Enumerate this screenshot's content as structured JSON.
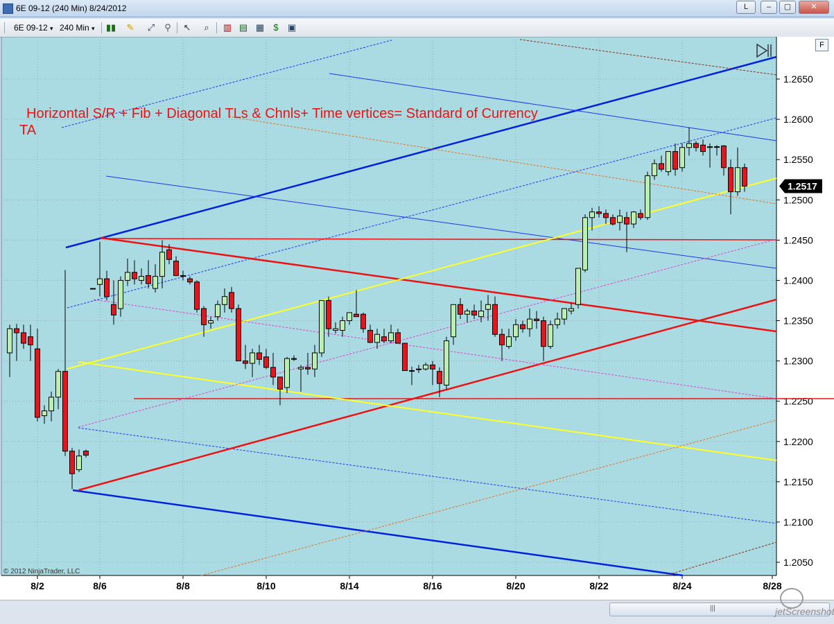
{
  "window": {
    "title": "6E 09-12 (240 Min)  8/24/2012",
    "btn_l": "L",
    "btn_min": "–",
    "btn_max": "▢",
    "btn_close": "✕"
  },
  "toolbar": {
    "instrument": "6E 09-12",
    "interval": "240 Min",
    "dropdown": "▾",
    "f_button": "F"
  },
  "chart_data": {
    "type": "candlestick",
    "title": "Horizontal S/R + Fib + Diagonal TLs & Chnls+ Time vertices= Standard of Currency",
    "title_line2": "TA",
    "copyright": "© 2012 NinjaTrader, LLC",
    "current_price": "1.2517",
    "ylim": [
      1.202,
      1.2715
    ],
    "y_ticks": [
      "1.2650",
      "1.2600",
      "1.2550",
      "1.2500",
      "1.2450",
      "1.2400",
      "1.2350",
      "1.2300",
      "1.2250",
      "1.2200",
      "1.2150",
      "1.2100",
      "1.2050"
    ],
    "x_labels": [
      "8/2",
      "8/6",
      "8/8",
      "8/10",
      "8/14",
      "8/16",
      "8/20",
      "8/22",
      "8/24",
      "8/28"
    ],
    "x_label_index": [
      4,
      13,
      25,
      37,
      49,
      61,
      73,
      85,
      97,
      110
    ],
    "colors": {
      "bg": "#aadbe3",
      "up": "#b8f0b0",
      "down": "#e8141c",
      "wick": "#000000"
    },
    "candles": [
      [
        1.231,
        1.2345,
        1.228,
        1.234
      ],
      [
        1.234,
        1.2346,
        1.23,
        1.2335
      ],
      [
        1.2335,
        1.2345,
        1.2315,
        1.2322
      ],
      [
        1.233,
        1.2345,
        1.23,
        1.232
      ],
      [
        1.2315,
        1.234,
        1.2225,
        1.223
      ],
      [
        1.2232,
        1.2245,
        1.2222,
        1.2238
      ],
      [
        1.2238,
        1.2262,
        1.2225,
        1.2255
      ],
      [
        1.2255,
        1.229,
        1.224,
        1.2287
      ],
      [
        1.2287,
        1.2413,
        1.2182,
        1.2188
      ],
      [
        1.2188,
        1.2192,
        1.2141,
        1.216
      ],
      [
        1.2165,
        1.219,
        1.2162,
        1.2182
      ],
      [
        1.2188,
        1.219,
        1.218,
        1.2183
      ],
      [
        1.239,
        1.239,
        1.239,
        1.239
      ],
      [
        1.2395,
        1.2448,
        1.238,
        1.2402
      ],
      [
        1.2402,
        1.2412,
        1.2375,
        1.238
      ],
      [
        1.237,
        1.24,
        1.2345,
        1.2357
      ],
      [
        1.2365,
        1.2405,
        1.2355,
        1.24
      ],
      [
        1.24,
        1.2427,
        1.2393,
        1.241
      ],
      [
        1.241,
        1.2425,
        1.2395,
        1.2402
      ],
      [
        1.24,
        1.2415,
        1.2395,
        1.2405
      ],
      [
        1.2406,
        1.2425,
        1.239,
        1.2396
      ],
      [
        1.239,
        1.242,
        1.2385,
        1.2405
      ],
      [
        1.2405,
        1.245,
        1.239,
        1.2435
      ],
      [
        1.2438,
        1.2445,
        1.242,
        1.2426
      ],
      [
        1.2424,
        1.243,
        1.2405,
        1.2406
      ],
      [
        1.2406,
        1.2412,
        1.24,
        1.2405
      ],
      [
        1.2402,
        1.2405,
        1.2395,
        1.2398
      ],
      [
        1.2398,
        1.24,
        1.236,
        1.2364
      ],
      [
        1.2365,
        1.2368,
        1.233,
        1.2345
      ],
      [
        1.2347,
        1.2355,
        1.234,
        1.235
      ],
      [
        1.2355,
        1.2375,
        1.235,
        1.237
      ],
      [
        1.237,
        1.239,
        1.236,
        1.238
      ],
      [
        1.2385,
        1.2392,
        1.236,
        1.2365
      ],
      [
        1.2365,
        1.237,
        1.23,
        1.23
      ],
      [
        1.23,
        1.232,
        1.229,
        1.2297
      ],
      [
        1.2297,
        1.2315,
        1.228,
        1.231
      ],
      [
        1.231,
        1.232,
        1.2295,
        1.2302
      ],
      [
        1.2305,
        1.2315,
        1.229,
        1.2292
      ],
      [
        1.2292,
        1.231,
        1.227,
        1.228
      ],
      [
        1.228,
        1.2265,
        1.2245,
        1.2265
      ],
      [
        1.2267,
        1.2305,
        1.226,
        1.2303
      ],
      [
        1.2303,
        1.2307,
        1.23,
        1.2302
      ],
      [
        1.229,
        1.2295,
        1.2262,
        1.2292
      ],
      [
        1.2292,
        1.231,
        1.2283,
        1.229
      ],
      [
        1.229,
        1.232,
        1.228,
        1.231
      ],
      [
        1.231,
        1.236,
        1.2305,
        1.2375
      ],
      [
        1.2375,
        1.238,
        1.233,
        1.234
      ],
      [
        1.2338,
        1.2348,
        1.2334,
        1.234
      ],
      [
        1.2338,
        1.2355,
        1.233,
        1.235
      ],
      [
        1.235,
        1.236,
        1.2345,
        1.236
      ],
      [
        1.2358,
        1.2388,
        1.2355,
        1.2355
      ],
      [
        1.2358,
        1.236,
        1.2335,
        1.234
      ],
      [
        1.2338,
        1.2345,
        1.2322,
        1.2323
      ],
      [
        1.2323,
        1.234,
        1.2315,
        1.2333
      ],
      [
        1.233,
        1.234,
        1.2322,
        1.2325
      ],
      [
        1.2325,
        1.2345,
        1.2322,
        1.2335
      ],
      [
        1.2335,
        1.234,
        1.2322,
        1.2322
      ],
      [
        1.2322,
        1.232,
        1.2288,
        1.2288
      ],
      [
        1.2288,
        1.2293,
        1.227,
        1.2288
      ],
      [
        1.229,
        1.2295,
        1.2285,
        1.229
      ],
      [
        1.229,
        1.2298,
        1.2288,
        1.2295
      ],
      [
        1.2295,
        1.23,
        1.227,
        1.229
      ],
      [
        1.2287,
        1.2292,
        1.2255,
        1.2272
      ],
      [
        1.227,
        1.233,
        1.2265,
        1.2325
      ],
      [
        1.233,
        1.2368,
        1.232,
        1.237
      ],
      [
        1.237,
        1.2378,
        1.2352,
        1.2358
      ],
      [
        1.2358,
        1.2365,
        1.2348,
        1.2362
      ],
      [
        1.2362,
        1.237,
        1.2352,
        1.2357
      ],
      [
        1.2355,
        1.2375,
        1.2348,
        1.2362
      ],
      [
        1.2364,
        1.2382,
        1.235,
        1.237
      ],
      [
        1.237,
        1.238,
        1.233,
        1.2333
      ],
      [
        1.2333,
        1.234,
        1.23,
        1.232
      ],
      [
        1.2318,
        1.234,
        1.2315,
        1.233
      ],
      [
        1.233,
        1.2352,
        1.2325,
        1.2345
      ],
      [
        1.2345,
        1.235,
        1.2335,
        1.234
      ],
      [
        1.234,
        1.2365,
        1.233,
        1.2352
      ],
      [
        1.2352,
        1.2362,
        1.234,
        1.235
      ],
      [
        1.235,
        1.2355,
        1.23,
        1.2318
      ],
      [
        1.2318,
        1.235,
        1.2315,
        1.2345
      ],
      [
        1.2345,
        1.236,
        1.234,
        1.2352
      ],
      [
        1.2352,
        1.2365,
        1.2345,
        1.2365
      ],
      [
        1.2362,
        1.2372,
        1.2358,
        1.2365
      ],
      [
        1.237,
        1.2415,
        1.2365,
        1.2415
      ],
      [
        1.2413,
        1.2482,
        1.241,
        1.2478
      ],
      [
        1.2478,
        1.249,
        1.2462,
        1.2485
      ],
      [
        1.2485,
        1.2492,
        1.2478,
        1.2483
      ],
      [
        1.2483,
        1.2488,
        1.247,
        1.2478
      ],
      [
        1.2478,
        1.2482,
        1.2468,
        1.247
      ],
      [
        1.2472,
        1.2488,
        1.2462,
        1.248
      ],
      [
        1.2478,
        1.2485,
        1.2435,
        1.247
      ],
      [
        1.247,
        1.2486,
        1.2465,
        1.2485
      ],
      [
        1.2483,
        1.2488,
        1.2475,
        1.2478
      ],
      [
        1.2478,
        1.2535,
        1.2475,
        1.253
      ],
      [
        1.253,
        1.255,
        1.2525,
        1.2545
      ],
      [
        1.2545,
        1.2555,
        1.2535,
        1.2538
      ],
      [
        1.2535,
        1.256,
        1.253,
        1.256
      ],
      [
        1.256,
        1.257,
        1.253,
        1.2538
      ],
      [
        1.254,
        1.257,
        1.2535,
        1.2565
      ],
      [
        1.2565,
        1.259,
        1.2555,
        1.257
      ],
      [
        1.257,
        1.2573,
        1.256,
        1.2565
      ],
      [
        1.2568,
        1.2575,
        1.2555,
        1.256
      ],
      [
        1.2565,
        1.257,
        1.254,
        1.2566
      ],
      [
        1.2566,
        1.2568,
        1.2555,
        1.2566
      ],
      [
        1.2567,
        1.2568,
        1.253,
        1.254
      ],
      [
        1.254,
        1.255,
        1.2482,
        1.251
      ],
      [
        1.251,
        1.2565,
        1.2505,
        1.254
      ],
      [
        1.254,
        1.2545,
        1.251,
        1.2517
      ]
    ]
  }
}
